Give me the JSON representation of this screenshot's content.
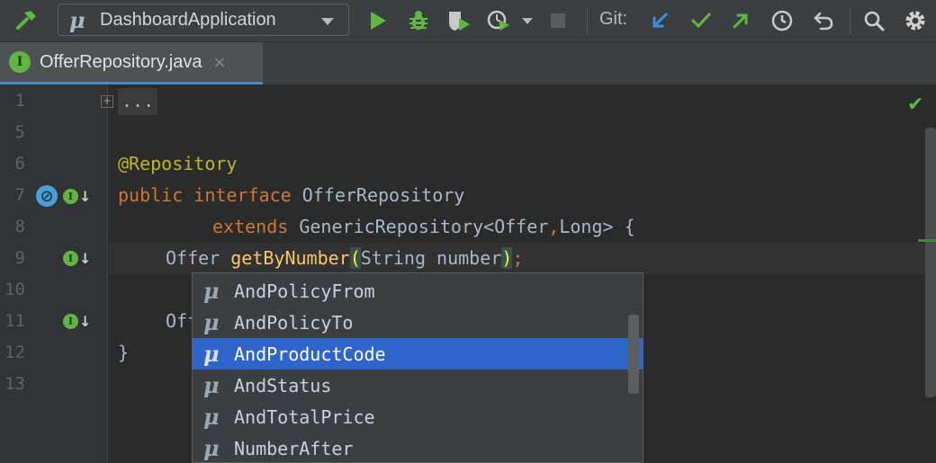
{
  "toolbar": {
    "run_config": "DashboardApplication",
    "git_label": "Git:"
  },
  "tab": {
    "badge": "I",
    "title": "OfferRepository.java",
    "close": "×"
  },
  "editor": {
    "line_numbers": [
      "1",
      "5",
      "6",
      "7",
      "8",
      "9",
      "10",
      "11",
      "12",
      "13"
    ],
    "folded_text": "...",
    "fold_marker": "+",
    "gutter_badge": "I",
    "gutter_arrow": "↓",
    "lines": {
      "annotation": "@Repository",
      "l7_kw1": "public",
      "l7_kw2": "interface",
      "l7_name": " OfferRepository",
      "l8_kw": "extends",
      "l8_type": " GenericRepository<Offer",
      "l8_comma": ",",
      "l8_rest": "Long> {",
      "l9_type": "Offer ",
      "l9_method": "getByNumber",
      "l9_open": "(",
      "l9_params": "String number",
      "l9_close": ")",
      "l9_semi": ";",
      "l11_text": "Off",
      "l12_text": "}"
    }
  },
  "completion": {
    "icon_char": "μ",
    "items": [
      "AndPolicyFrom",
      "AndPolicyTo",
      "AndProductCode",
      "AndStatus",
      "AndTotalPrice",
      "NumberAfter"
    ],
    "selected": "AndProductCode"
  }
}
